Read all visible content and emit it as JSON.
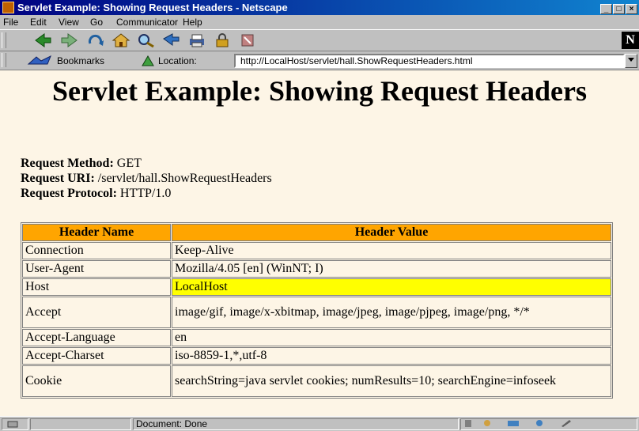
{
  "window": {
    "title": "Servlet Example: Showing Request Headers - Netscape",
    "controls": [
      "_",
      "□",
      "×"
    ]
  },
  "menu": [
    "File",
    "Edit",
    "View",
    "Go",
    "Communicator",
    "Help"
  ],
  "toolbar": {
    "buttons": [
      "back-icon",
      "forward-icon",
      "reload-icon",
      "home-icon",
      "search-icon",
      "guide-icon",
      "print-icon",
      "security-icon",
      "stop-icon"
    ],
    "logo": "N"
  },
  "location": {
    "bookmarks_label": "Bookmarks",
    "location_label": "Location:",
    "url": "http://LocalHost/servlet/hall.ShowRequestHeaders.html"
  },
  "page": {
    "heading": "Servlet Example: Showing Request Headers",
    "method_label": "Request Method:",
    "method": "GET",
    "uri_label": "Request URI:",
    "uri": "/servlet/hall.ShowRequestHeaders",
    "protocol_label": "Request Protocol:",
    "protocol": "HTTP/1.0",
    "table": {
      "columns": [
        "Header Name",
        "Header Value"
      ],
      "rows": [
        {
          "name": "Connection",
          "value": "Keep-Alive"
        },
        {
          "name": "User-Agent",
          "value": "Mozilla/4.05 [en] (WinNT; I)"
        },
        {
          "name": "Host",
          "value": "LocalHost",
          "highlight": "#ffff00"
        },
        {
          "name": "Accept",
          "value": "image/gif, image/x-xbitmap, image/jpeg, image/pjpeg, image/png, */*"
        },
        {
          "name": "Accept-Language",
          "value": "en"
        },
        {
          "name": "Accept-Charset",
          "value": "iso-8859-1,*,utf-8"
        },
        {
          "name": "Cookie",
          "value": "searchString=java servlet cookies; numResults=10; searchEngine=infoseek"
        }
      ]
    }
  },
  "status": {
    "text": "Document: Done"
  },
  "colors": {
    "page_bg": "#fdf5e6",
    "header_bg": "#ffa500",
    "highlight": "#ffff00",
    "titlebar": "#000080"
  }
}
